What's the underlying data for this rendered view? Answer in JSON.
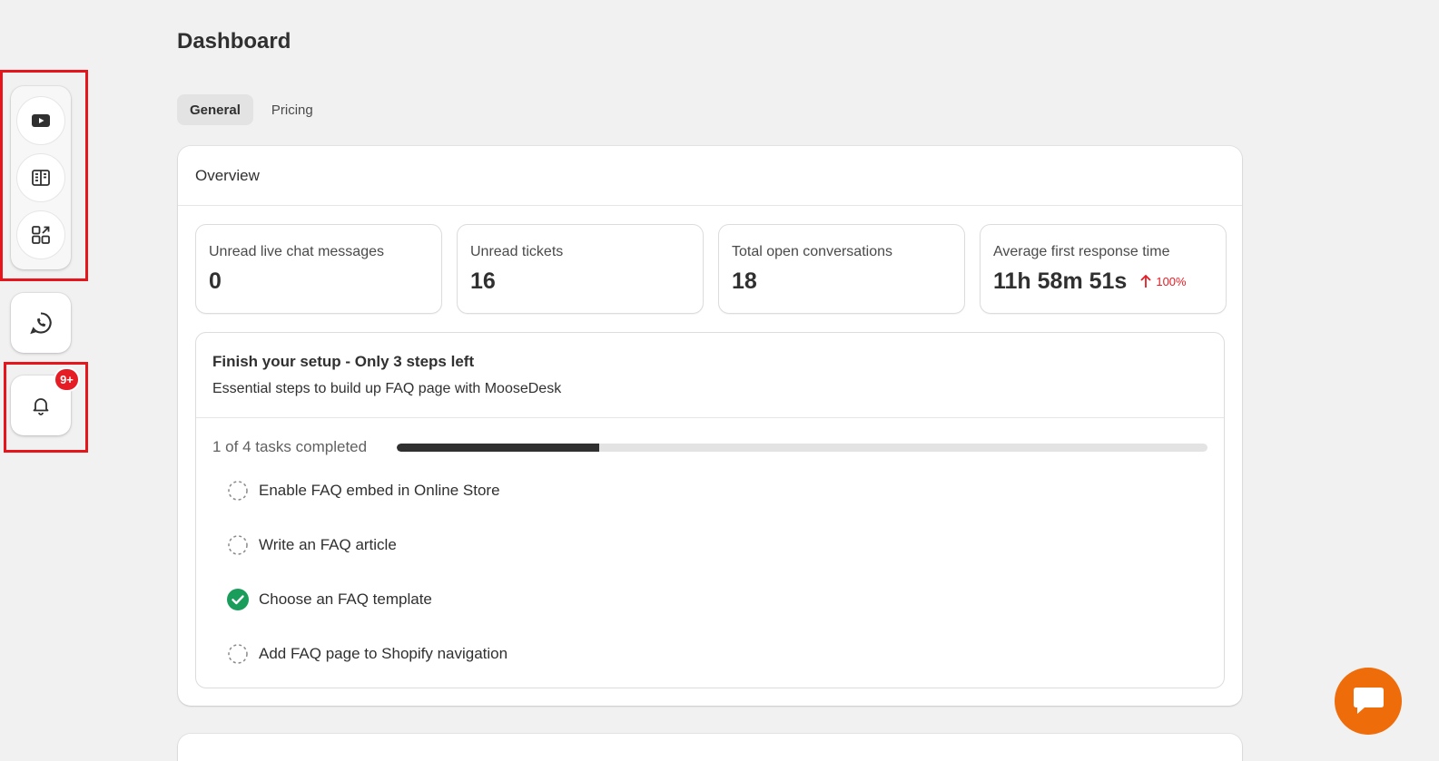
{
  "page": {
    "title": "Dashboard"
  },
  "tabs": [
    {
      "label": "General",
      "active": true
    },
    {
      "label": "Pricing",
      "active": false
    }
  ],
  "rail": {
    "items": [
      {
        "icon": "youtube-icon"
      },
      {
        "icon": "book-icon"
      },
      {
        "icon": "apps-icon"
      },
      {
        "icon": "whatsapp-icon"
      },
      {
        "icon": "bell-icon"
      }
    ],
    "notification_badge": "9+",
    "highlight_color": "#e8141b"
  },
  "overview": {
    "title": "Overview",
    "stats": [
      {
        "label": "Unread live chat messages",
        "value": "0"
      },
      {
        "label": "Unread tickets",
        "value": "16"
      },
      {
        "label": "Total open conversations",
        "value": "18"
      },
      {
        "label": "Average first response time",
        "value": "11h 58m 51s",
        "trend": "100%",
        "trend_direction": "up",
        "trend_color": "#e51c23"
      }
    ]
  },
  "setup": {
    "title": "Finish your setup - Only 3 steps left",
    "subtitle": "Essential steps to build up FAQ page with MooseDesk",
    "progress_text": "1 of 4 tasks completed",
    "progress_fraction": 0.25,
    "tasks": [
      {
        "label": "Enable FAQ embed in Online Store",
        "done": false
      },
      {
        "label": "Write an FAQ article",
        "done": false
      },
      {
        "label": "Choose an FAQ template",
        "done": true
      },
      {
        "label": "Add FAQ page to Shopify navigation",
        "done": false
      }
    ]
  },
  "colors": {
    "accent_chat": "#ef6c0a",
    "done_green": "#1a9c5b",
    "badge_red": "#e51c23"
  }
}
